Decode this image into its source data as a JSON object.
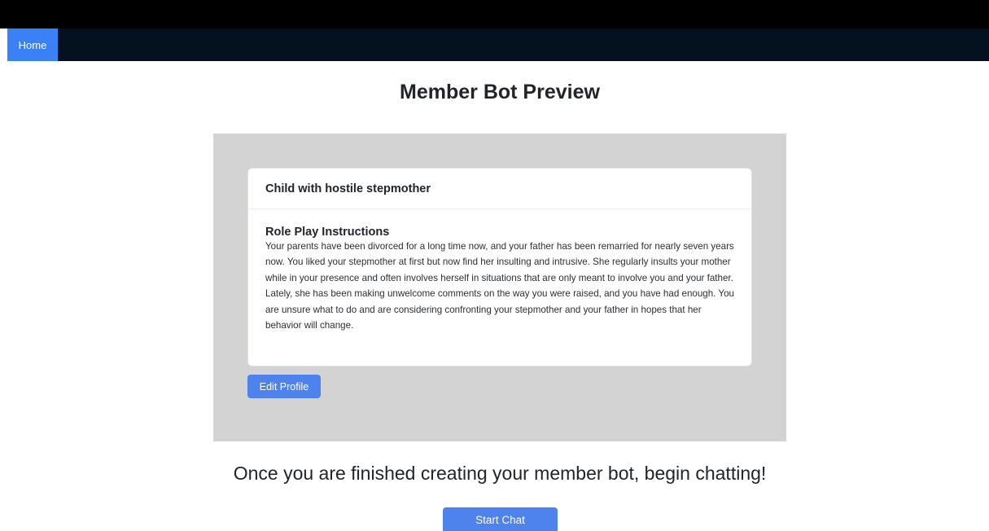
{
  "nav": {
    "home_label": "Home"
  },
  "page": {
    "title": "Member Bot Preview"
  },
  "profile_card": {
    "title": "Child with hostile stepmother",
    "section_title": "Role Play Instructions",
    "instructions": "Your parents have been divorced for a long time now, and your father has been remarried for nearly seven years now. You liked your stepmother at first but now find her insulting and intrusive. She regularly insults your mother while in your presence and often involves herself in situations that are only meant to involve you and your father. Lately, she has been making unwelcome comments on the way you were raised, and you have had enough. You are unsure what to do and are considering confronting your stepmother and your father in hopes that her behavior will change."
  },
  "actions": {
    "edit_profile_label": "Edit Profile",
    "cta_text": "Once you are finished creating your member bot, begin chatting!",
    "start_chat_label": "Start Chat"
  },
  "colors": {
    "top_bar": "#000000",
    "navbar": "#04111f",
    "nav_active": "#3a80f6",
    "button": "#4e82ec",
    "panel": "#d3d3d3"
  }
}
